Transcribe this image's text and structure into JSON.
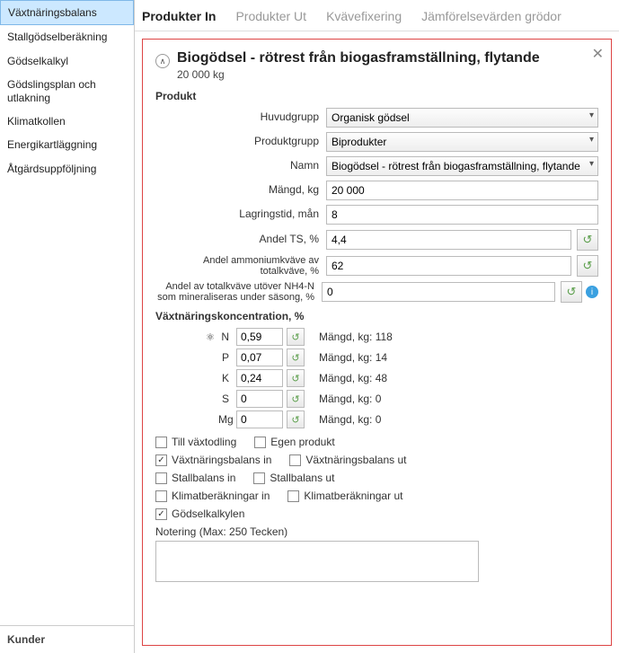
{
  "sidebar": {
    "items": [
      "Växtnäringsbalans",
      "Stallgödselberäkning",
      "Gödselkalkyl",
      "Gödslingsplan och utlakning",
      "Klimatkollen",
      "Energikartläggning",
      "Åtgärdsuppföljning"
    ],
    "footer": "Kunder"
  },
  "tabs": [
    "Produkter In",
    "Produkter Ut",
    "Kvävefixering",
    "Jämförelsevärden grödor"
  ],
  "panel": {
    "title": "Biogödsel - rötrest från biogasframställning, flytande",
    "subtitle": "20 000 kg",
    "section_product": "Produkt",
    "labels": {
      "huvudgrupp": "Huvudgrupp",
      "produktgrupp": "Produktgrupp",
      "namn": "Namn",
      "mangd": "Mängd, kg",
      "lagringstid": "Lagringstid, mån",
      "andel_ts": "Andel TS, %",
      "andel_amm": "Andel ammoniumkväve av totalkväve, %",
      "andel_tot": "Andel av totalkväve utöver NH4-N som mineraliseras under säsong, %",
      "vaxtkonc": "Växtnäringskoncentration, %",
      "mangd_kg": "Mängd, kg:",
      "notering": "Notering (Max: 250 Tecken)"
    },
    "values": {
      "huvudgrupp": "Organisk gödsel",
      "produktgrupp": "Biprodukter",
      "namn": "Biogödsel - rötrest från biogasframställning, flytande",
      "mangd": "20 000",
      "lagringstid": "8",
      "andel_ts": "4,4",
      "andel_amm": "62",
      "andel_tot": "0"
    },
    "nutrients": [
      {
        "sym": "N",
        "val": "0,59",
        "amt": "118",
        "icon": true
      },
      {
        "sym": "P",
        "val": "0,07",
        "amt": "14",
        "icon": false
      },
      {
        "sym": "K",
        "val": "0,24",
        "amt": "48",
        "icon": false
      },
      {
        "sym": "S",
        "val": "0",
        "amt": "0",
        "icon": false
      },
      {
        "sym": "Mg",
        "val": "0",
        "amt": "0",
        "icon": false
      }
    ],
    "checks": {
      "till_vaxt": "Till växtodling",
      "egen_prod": "Egen produkt",
      "vnb_in": "Växtnäringsbalans in",
      "vnb_ut": "Växtnäringsbalans ut",
      "stall_in": "Stallbalans in",
      "stall_ut": "Stallbalans ut",
      "klimat_in": "Klimatberäkningar in",
      "klimat_ut": "Klimatberäkningar ut",
      "godsel": "Gödselkalkylen"
    }
  }
}
